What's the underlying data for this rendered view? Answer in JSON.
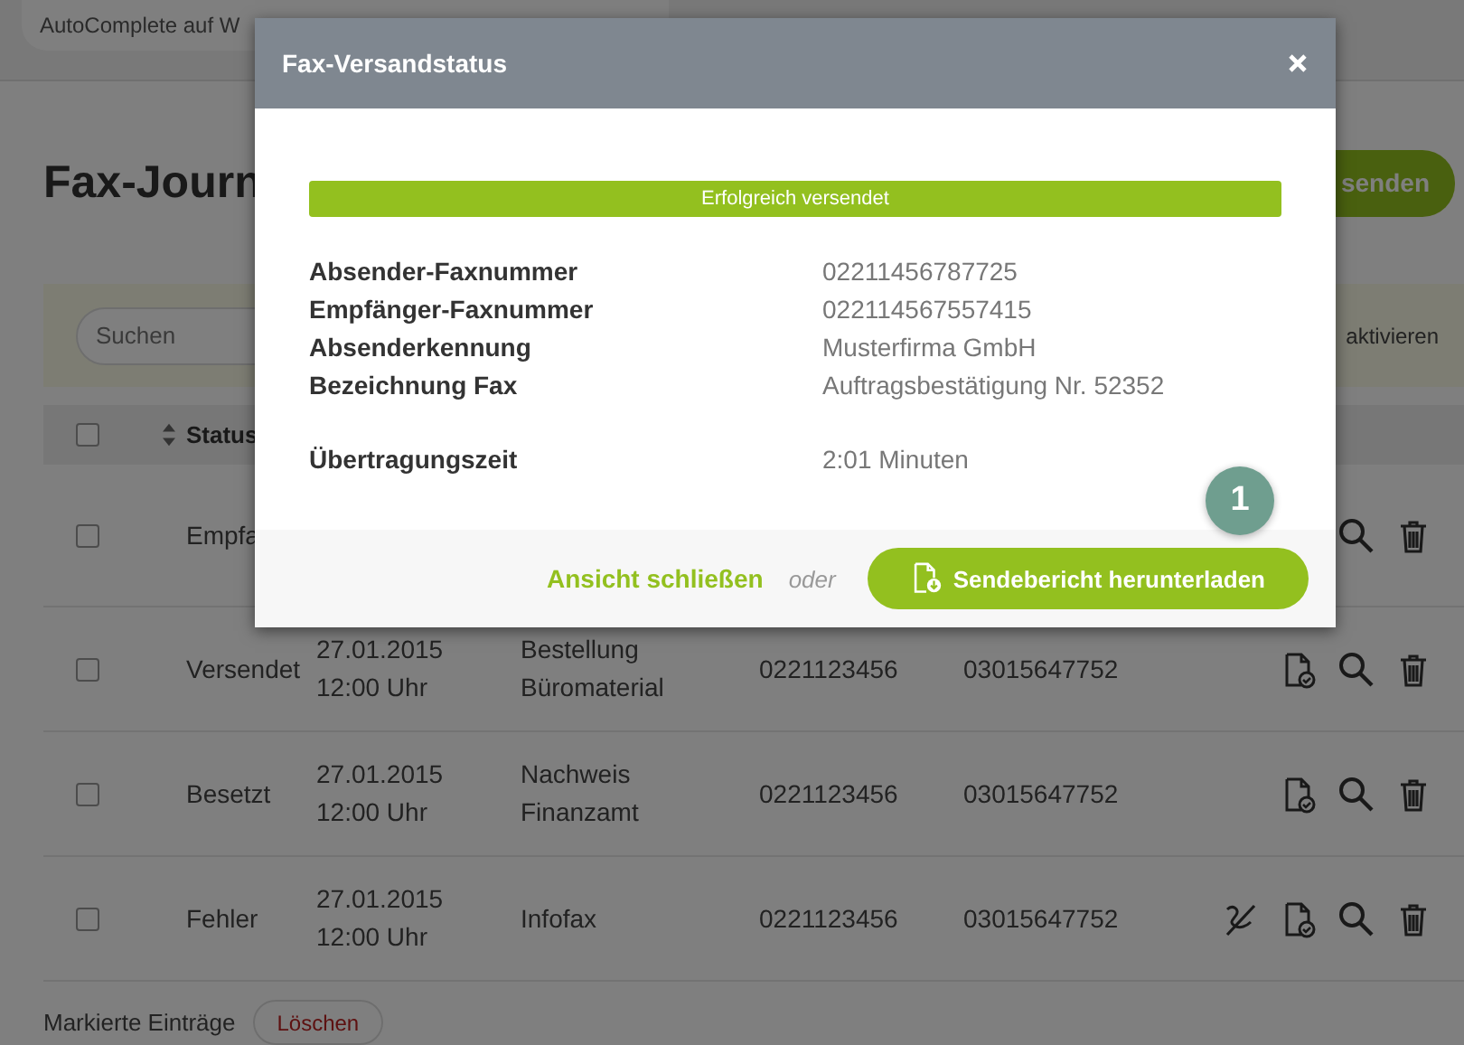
{
  "top_bar": {
    "search": {
      "value": "AutoComplete auf W"
    }
  },
  "page_title": "Fax-Journ",
  "send_button": "senden",
  "filter": {
    "search": {
      "placeholder": "Suchen"
    },
    "toggle_link": "aktivieren"
  },
  "table": {
    "select_all": {
      "checked": false
    },
    "columns": [
      {
        "label": "Status"
      }
    ],
    "rows": [
      {
        "checked": false,
        "status": "Empfa",
        "can_cancel": false
      },
      {
        "checked": false,
        "status": "Versendet",
        "date": "27.01.2015",
        "time": "12:00 Uhr",
        "subject": "Bestellung Büromaterial",
        "sender": "0221123456",
        "recipient": "03015647752",
        "can_cancel": false
      },
      {
        "checked": false,
        "status": "Besetzt",
        "date": "27.01.2015",
        "time": "12:00 Uhr",
        "subject": "Nachweis Finanzamt",
        "sender": "0221123456",
        "recipient": "03015647752",
        "can_cancel": false
      },
      {
        "checked": false,
        "status": "Fehler",
        "date": "27.01.2015",
        "time": "12:00 Uhr",
        "subject": "Infofax",
        "sender": "0221123456",
        "recipient": "03015647752",
        "can_cancel": true
      }
    ]
  },
  "bulk": {
    "label": "Markierte Einträge",
    "delete_button": "Löschen"
  },
  "modal": {
    "title": "Fax-Versandstatus",
    "status": "Erfolgreich versendet",
    "details": [
      {
        "label": "Absender-Faxnummer",
        "value": "02211456787725"
      },
      {
        "label": "Empfänger-Faxnummer",
        "value": "022114567557415"
      },
      {
        "label": "Absenderkennung",
        "value": "Musterfirma GmbH"
      },
      {
        "label": "Bezeichnung Fax",
        "value": "Auftragsbestätigung Nr. 52352"
      }
    ],
    "transfer": {
      "label": "Übertragungszeit",
      "value": "2:01 Minuten"
    },
    "close_link": "Ansicht schließen",
    "separator": "oder",
    "download_button": "Sendebericht herunterladen",
    "callout": "1"
  }
}
